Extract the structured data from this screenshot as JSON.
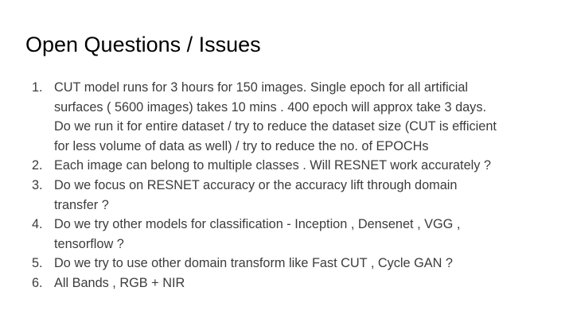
{
  "slide": {
    "title": "Open Questions / Issues",
    "items": [
      {
        "number": "1.",
        "text": "CUT model runs for 3 hours for 150 images. Single epoch for all artificial\nsurfaces ( 5600 images) takes 10 mins . 400 epoch will approx take 3 days.\nDo we run it for entire dataset /  try to reduce the dataset size (CUT is efficient\nfor less volume of data as well) / try to reduce the no. of EPOCHs"
      },
      {
        "number": "2.",
        "text": "Each image can belong to multiple classes . Will RESNET work accurately ?"
      },
      {
        "number": "3.",
        "text": "Do we focus on RESNET accuracy or the accuracy lift through domain\ntransfer ?"
      },
      {
        "number": "4.",
        "text": "Do we try other models for classification - Inception , Densenet , VGG ,\ntensorflow ?"
      },
      {
        "number": "5.",
        "text": "Do we try to use other domain transform like Fast CUT , Cycle GAN ?"
      },
      {
        "number": "6.",
        "text": "All Bands , RGB + NIR"
      }
    ]
  }
}
